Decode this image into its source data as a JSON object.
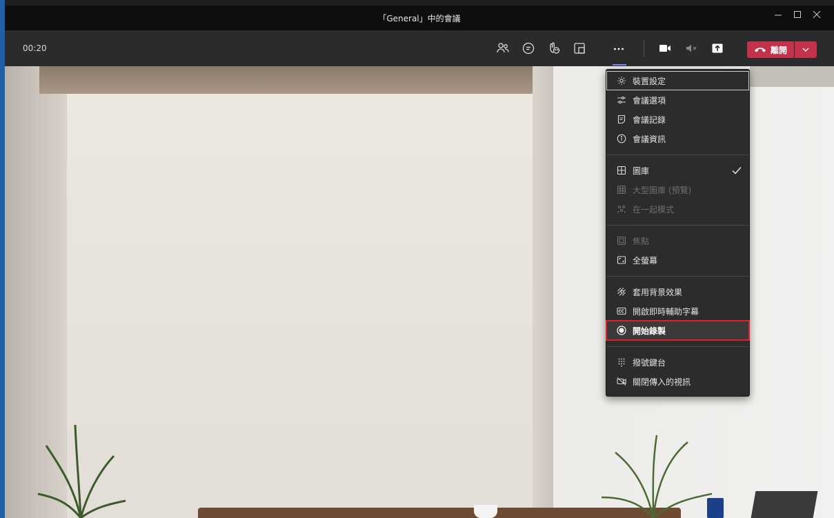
{
  "window": {
    "title": "「General」中的會議",
    "minimize_icon": "minimize-icon",
    "maximize_icon": "maximize-icon",
    "close_icon": "close-icon"
  },
  "toolbar": {
    "timer": "00:20",
    "leave_label": "離開",
    "buttons": [
      "people-icon",
      "chat-icon",
      "reactions-icon",
      "rooms-icon",
      "more-icon",
      "camera-icon",
      "mic-muted-icon",
      "share-icon"
    ]
  },
  "menu": {
    "items": [
      {
        "label": "裝置設定",
        "icon": "gear-icon"
      },
      {
        "label": "會議選項",
        "icon": "sliders-icon"
      },
      {
        "label": "會議記錄",
        "icon": "notes-icon"
      },
      {
        "label": "會議資訊",
        "icon": "info-icon"
      },
      {
        "label": "圖庫",
        "icon": "gallery-icon",
        "checked": true
      },
      {
        "label": "大型圖庫 (預覽)",
        "icon": "large-gallery-icon",
        "disabled": true
      },
      {
        "label": "在一起模式",
        "icon": "together-mode-icon",
        "disabled": true
      },
      {
        "label": "焦點",
        "icon": "focus-icon",
        "disabled": true
      },
      {
        "label": "全螢幕",
        "icon": "fullscreen-icon"
      },
      {
        "label": "套用背景效果",
        "icon": "background-effects-icon"
      },
      {
        "label": "開啟即時輔助字幕",
        "icon": "captions-icon"
      },
      {
        "label": "開始錄製",
        "icon": "record-icon",
        "highlighted": true
      },
      {
        "label": "撥號鍵台",
        "icon": "dialpad-icon"
      },
      {
        "label": "關閉傳入的視訊",
        "icon": "video-off-icon"
      }
    ]
  },
  "colors": {
    "accent": "#7f85f5",
    "leave": "#c4314b",
    "highlight_border": "#e0202b"
  }
}
